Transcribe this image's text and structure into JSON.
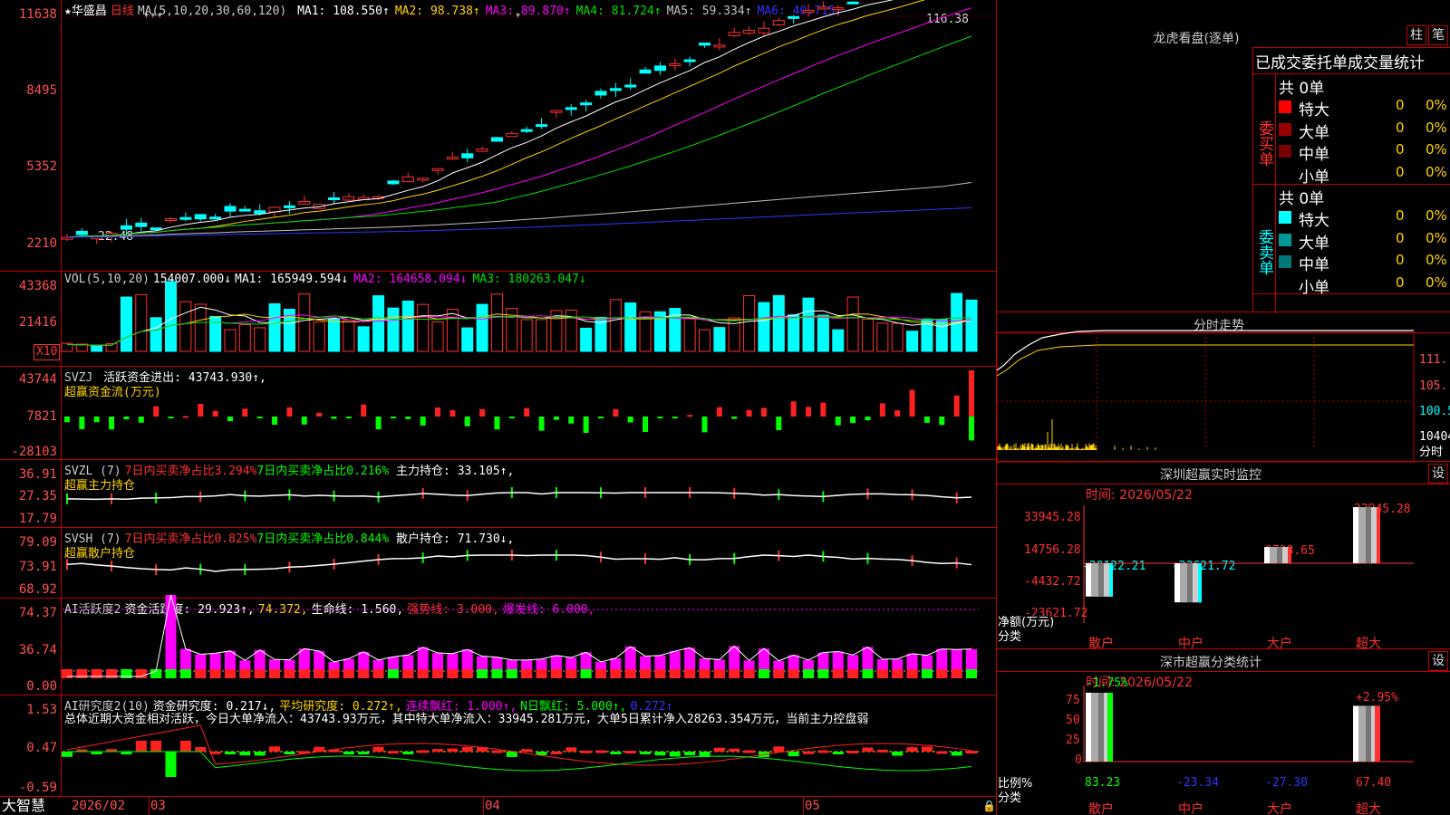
{
  "stock": {
    "name": "华盛昌",
    "period": "日线",
    "star": "★"
  },
  "main": {
    "ma_label": "MA(5,10,20,30,60,120)",
    "ma": [
      {
        "label": "MA1:",
        "value": "108.550↑",
        "color": "#ffffff"
      },
      {
        "label": "MA2:",
        "value": "98.738↑",
        "color": "#ffd400"
      },
      {
        "label": "MA3:",
        "value": "89.870↑",
        "color": "#ff00ff"
      },
      {
        "label": "MA4:",
        "value": "81.724↑",
        "color": "#00e000"
      },
      {
        "label": "MA5:",
        "value": "59.334↑",
        "color": "#c0c0c0"
      },
      {
        "label": "MA6:",
        "value": "40.715↑",
        "color": "#3333ff"
      }
    ],
    "y_labels": [
      "11638",
      "8495",
      "5352",
      "2210"
    ],
    "high_label": "116.38",
    "low_label": "22.48",
    "markers": [
      "***",
      "*"
    ]
  },
  "vol": {
    "name": "VOL(5,10,20)",
    "value": "154007.000↓",
    "ma": [
      {
        "label": "MA1:",
        "value": "165949.594↓",
        "color": "#ffffff"
      },
      {
        "label": "MA2:",
        "value": "164658.094↓",
        "color": "#ff00ff"
      },
      {
        "label": "MA3:",
        "value": "180263.047↓",
        "color": "#00e000"
      }
    ],
    "y_labels": [
      "43368",
      "21416"
    ],
    "unit": "X10"
  },
  "svzj": {
    "name": "SVZJ",
    "text": "活跃资金进出: 43743.930↑,",
    "sub": "超赢资金流(万元)",
    "y_labels": [
      "43744",
      "7821",
      "-28103"
    ]
  },
  "svzl": {
    "name": "SVZL (7)",
    "a": "7日内买卖净占比3.294%",
    "b": "7日内买卖净占比0.216%",
    "c": "主力持仓: 33.105↑,",
    "sub": "超赢主力持仓",
    "y_labels": [
      "36.91",
      "27.35",
      "17.79"
    ]
  },
  "svsh": {
    "name": "SVSH (7)",
    "a": "7日内买卖净占比0.825%",
    "b": "7日内买卖净占比0.844%",
    "c": "散户持仓: 71.730↓,",
    "sub": "超赢散户持仓",
    "y_labels": [
      "79.09",
      "73.91",
      "68.92"
    ]
  },
  "aihy": {
    "name": "AI活跃度2",
    "a": "资金活跃度: 29.923↑,",
    "b": "74.372,",
    "c": "生命线: 1.560,",
    "d": "强势线: 3.000,",
    "e": "爆发线: 6.000,",
    "y_labels": [
      "74.37",
      "36.74",
      "0.00"
    ]
  },
  "aiyj": {
    "name": "AI研究度2(10)",
    "a": "资金研究度: 0.217↓,",
    "b": "平均研究度: 0.272↑,",
    "c": "连续飘红: 1.000↑,",
    "d": "N日飘红: 5.000↑,",
    "e": "0.272↑",
    "summary": "总体近期大资金相对活跃，今日大单净流入：43743.93万元，其中特大单净流入：33945.281万元，大单5日累计净入28263.354万元，当前主力控盘弱",
    "y_labels": [
      "1.53",
      "0.47",
      "-0.59"
    ]
  },
  "xaxis": {
    "brand": "大智慧",
    "labels": [
      "2026/02",
      "03",
      "04",
      "05"
    ]
  },
  "lhkp": {
    "title": "龙虎看盘(逐单)",
    "btn1": "柱",
    "btn2": "笔",
    "stat_title": "已成交委托单成交量统计",
    "buy": {
      "side": "委买单",
      "total": "共 0单",
      "rows": [
        {
          "name": "特大",
          "count": "0",
          "pct": "0%",
          "color": "#ff0000"
        },
        {
          "name": "大单",
          "count": "0",
          "pct": "0%",
          "color": "#990000"
        },
        {
          "name": "中单",
          "count": "0",
          "pct": "0%",
          "color": "#770000"
        },
        {
          "name": "小单",
          "count": "0",
          "pct": "0%",
          "color": "#000000"
        }
      ]
    },
    "sell": {
      "side": "委卖单",
      "total": "共 0单",
      "rows": [
        {
          "name": "特大",
          "count": "0",
          "pct": "0%",
          "color": "#00ffff"
        },
        {
          "name": "大单",
          "count": "0",
          "pct": "0%",
          "color": "#009999"
        },
        {
          "name": "中单",
          "count": "0",
          "pct": "0%",
          "color": "#007777"
        },
        {
          "name": "小单",
          "count": "0",
          "pct": "0%",
          "color": "#000000"
        }
      ]
    }
  },
  "fszs": {
    "title": "分时走势",
    "y_labels": [
      "111.",
      "105.",
      "100.5",
      "10404"
    ],
    "unit": "分时"
  },
  "szjk": {
    "title": "深圳超赢实时监控",
    "btn": "设",
    "date": "时间: 2026/05/22",
    "y_labels": [
      "33945.28",
      "14756.28",
      "-4432.72",
      "-23621.72"
    ],
    "ylabel": "净额(万元)",
    "xlabel": "分类",
    "bars": [
      {
        "cat": "散户",
        "value": -20122.21,
        "label": "-20122.21"
      },
      {
        "cat": "中户",
        "value": -23621.72,
        "label": "-23621.72"
      },
      {
        "cat": "大户",
        "value": 9798.65,
        "label": "9798.65"
      },
      {
        "cat": "超大",
        "value": 33945.28,
        "label": "33945.28"
      }
    ]
  },
  "sslj": {
    "title": "深市超赢分类统计",
    "btn": "设",
    "date": "时间: 2026/05/22",
    "y_labels": [
      "75",
      "50",
      "25",
      "0"
    ],
    "ylabel": "比例%",
    "xlabel": "分类",
    "bars": [
      {
        "cat": "散户",
        "value": 83.23,
        "label": "83.23",
        "top": "-1.75%"
      },
      {
        "cat": "中户",
        "value": -23.34,
        "label": "-23.34",
        "top": ""
      },
      {
        "cat": "大户",
        "value": -27.3,
        "label": "-27.30",
        "top": ""
      },
      {
        "cat": "超大",
        "value": 67.4,
        "label": "67.40",
        "top": "+2.95%"
      }
    ]
  }
}
